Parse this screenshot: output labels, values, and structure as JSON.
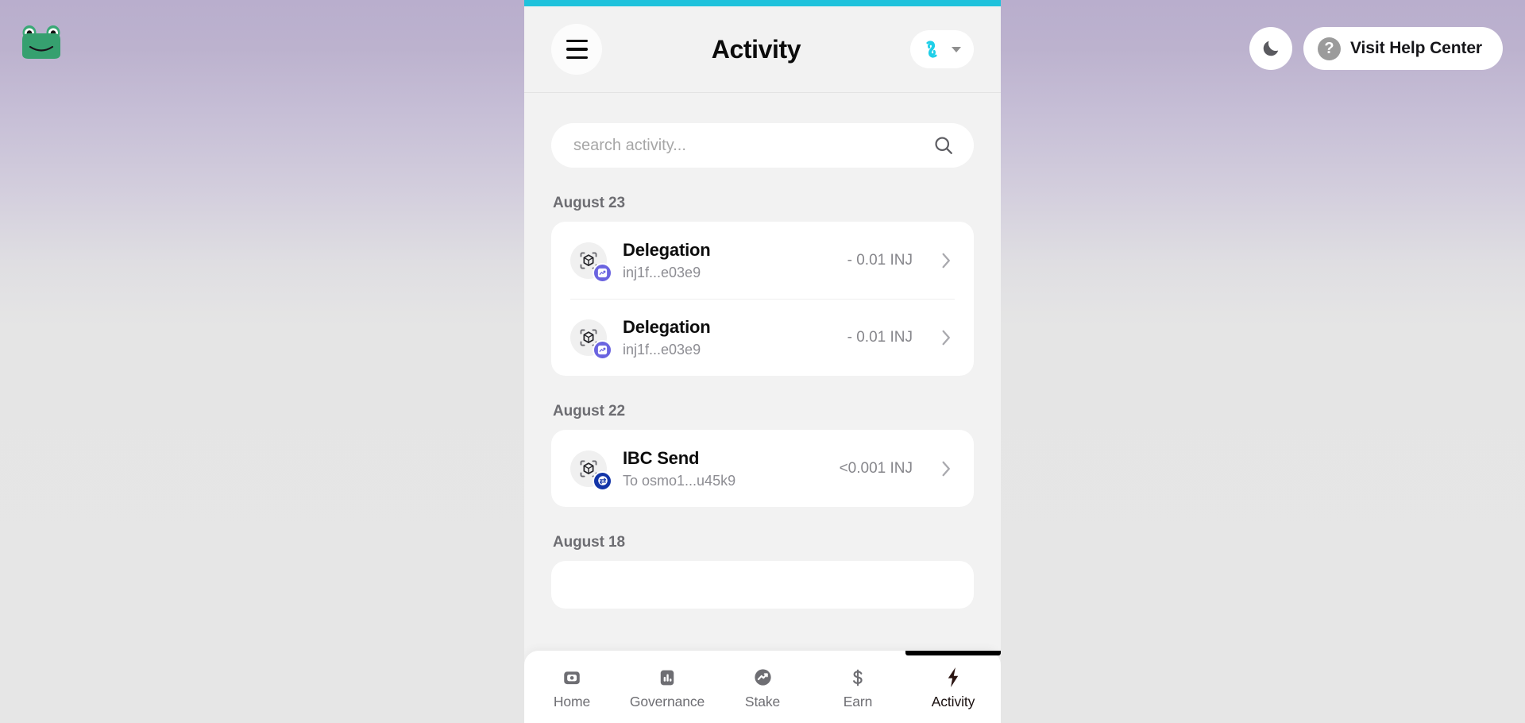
{
  "brand": {
    "logo_icon": "frog-logo-icon"
  },
  "top_bar": {
    "theme_toggle_icon": "moon-icon",
    "help_icon": "question-mark-icon",
    "help_label": "Visit Help Center"
  },
  "panel": {
    "accent_color": "#1ec2dc",
    "menu_icon": "hamburger-menu-icon",
    "title": "Activity",
    "chain_selector": {
      "chain_icon": "injective-logo-icon",
      "chevron_icon": "chevron-down-icon"
    }
  },
  "search": {
    "placeholder": "search activity...",
    "value": "",
    "icon": "search-icon"
  },
  "activity_groups": [
    {
      "date": "August 23",
      "transactions": [
        {
          "title": "Delegation",
          "subtitle": "inj1f...e03e9",
          "amount": "- 0.01 INJ",
          "type_icon": "cube-scan-icon",
          "badge_icon": "delegation-chart-icon",
          "badge_color": "#6b64e0",
          "chevron_icon": "chevron-right-icon"
        },
        {
          "title": "Delegation",
          "subtitle": "inj1f...e03e9",
          "amount": "- 0.01 INJ",
          "type_icon": "cube-scan-icon",
          "badge_icon": "delegation-chart-icon",
          "badge_color": "#6b64e0",
          "chevron_icon": "chevron-right-icon"
        }
      ]
    },
    {
      "date": "August 22",
      "transactions": [
        {
          "title": "IBC Send",
          "subtitle": "To osmo1...u45k9",
          "amount": "<0.001 INJ",
          "type_icon": "cube-scan-icon",
          "badge_icon": "ibc-transfer-icon",
          "badge_color": "#1335a8",
          "chevron_icon": "chevron-right-icon"
        }
      ]
    },
    {
      "date": "August 18",
      "transactions": []
    }
  ],
  "bottom_nav": {
    "items": [
      {
        "label": "Home",
        "icon": "wallet-icon",
        "active": false
      },
      {
        "label": "Governance",
        "icon": "bar-chart-icon",
        "active": false
      },
      {
        "label": "Stake",
        "icon": "trending-chart-icon",
        "active": false
      },
      {
        "label": "Earn",
        "icon": "dollar-sign-icon",
        "active": false
      },
      {
        "label": "Activity",
        "icon": "lightning-bolt-icon",
        "active": true
      }
    ]
  }
}
